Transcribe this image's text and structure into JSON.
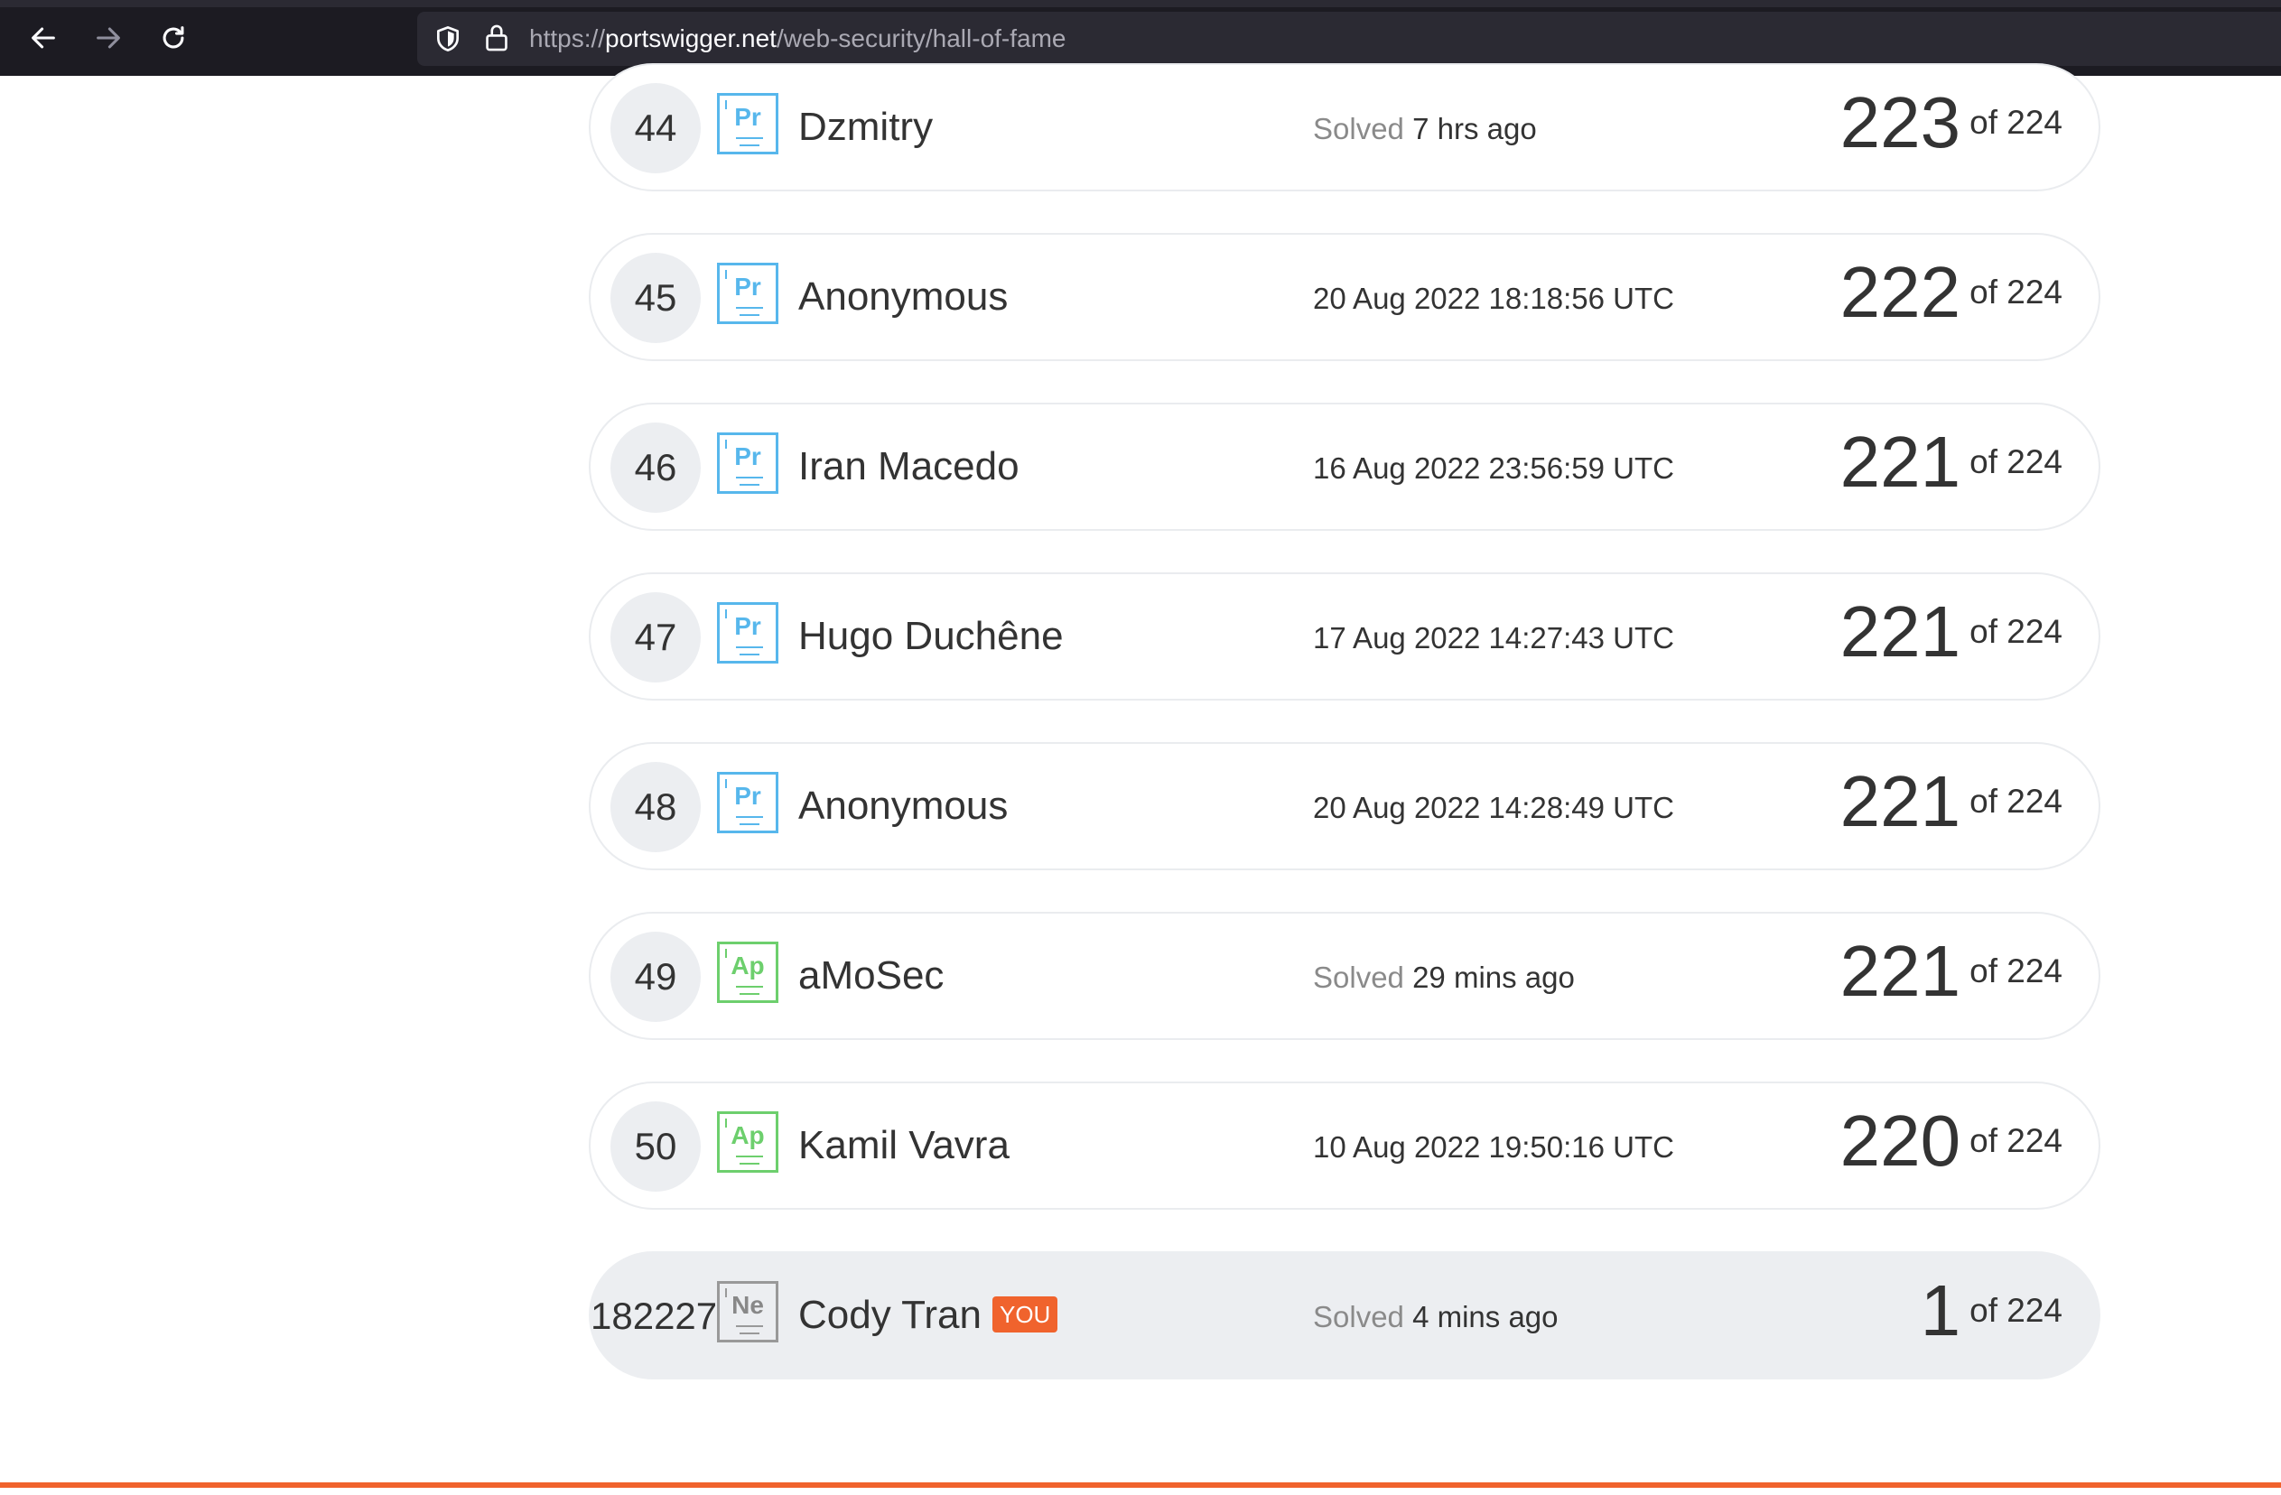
{
  "browser": {
    "url_prefix": "https://",
    "url_host": "portswigger.net",
    "url_path": "/web-security/hall-of-fame"
  },
  "leaderboard": {
    "total_label": "of 224",
    "rows": [
      {
        "rank": "44",
        "badge": "Pr",
        "badge_type": "pr",
        "name": "Dzmitry",
        "solved_label": "Solved",
        "time": "7 hrs ago",
        "score": "223"
      },
      {
        "rank": "45",
        "badge": "Pr",
        "badge_type": "pr",
        "name": "Anonymous",
        "solved_label": "",
        "time": "20 Aug 2022 18:18:56 UTC",
        "score": "222"
      },
      {
        "rank": "46",
        "badge": "Pr",
        "badge_type": "pr",
        "name": "Iran Macedo",
        "solved_label": "",
        "time": "16 Aug 2022 23:56:59 UTC",
        "score": "221"
      },
      {
        "rank": "47",
        "badge": "Pr",
        "badge_type": "pr",
        "name": "Hugo Duchêne",
        "solved_label": "",
        "time": "17 Aug 2022 14:27:43 UTC",
        "score": "221"
      },
      {
        "rank": "48",
        "badge": "Pr",
        "badge_type": "pr",
        "name": "Anonymous",
        "solved_label": "",
        "time": "20 Aug 2022 14:28:49 UTC",
        "score": "221"
      },
      {
        "rank": "49",
        "badge": "Ap",
        "badge_type": "ap",
        "name": "aMoSec",
        "solved_label": "Solved",
        "time": "29 mins ago",
        "score": "221"
      },
      {
        "rank": "50",
        "badge": "Ap",
        "badge_type": "ap",
        "name": "Kamil Vavra",
        "solved_label": "",
        "time": "10 Aug 2022 19:50:16 UTC",
        "score": "220"
      }
    ],
    "you_row": {
      "rank": "182227",
      "badge": "Ne",
      "badge_type": "ne",
      "name": "Cody Tran",
      "you_tag": "YOU",
      "solved_label": "Solved",
      "time": "4 mins ago",
      "score": "1"
    }
  },
  "colors": {
    "accent": "#f0632d",
    "practitioner": "#57b7ec",
    "apprentice": "#6dcf6d",
    "newcomer": "#999999"
  },
  "icons": {
    "back": "back-arrow-icon",
    "forward": "forward-arrow-icon",
    "reload": "reload-icon",
    "shield": "shield-icon",
    "lock": "lock-icon"
  }
}
